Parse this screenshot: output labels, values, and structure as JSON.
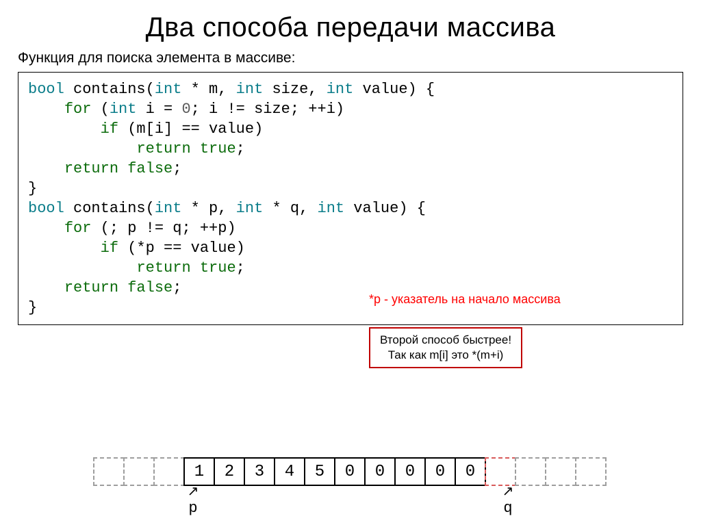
{
  "title": "Два способа передачи массива",
  "subtitle": "Функция для поиска элемента в массиве:",
  "code": {
    "l1": {
      "t1": "bool",
      "t2": " contains(",
      "t3": "int",
      "t4": " * m, ",
      "t5": "int",
      "t6": " size, ",
      "t7": "int",
      "t8": " value) {"
    },
    "l2": {
      "t1": "    ",
      "t2": "for",
      "t3": " (",
      "t4": "int",
      "t5": " i = ",
      "t6": "0",
      "t7": "; i != size; ++i)"
    },
    "l3": {
      "t1": "        ",
      "t2": "if",
      "t3": " (m[i] == value)"
    },
    "l4": {
      "t1": "            ",
      "t2": "return",
      "t3": " ",
      "t4": "true",
      "t5": ";"
    },
    "l5": {
      "t1": "    ",
      "t2": "return",
      "t3": " ",
      "t4": "false",
      "t5": ";"
    },
    "l6": {
      "t1": "}"
    },
    "l7": {
      "t1": "bool",
      "t2": " contains(",
      "t3": "int",
      "t4": " * p, ",
      "t5": "int",
      "t6": " * q, ",
      "t7": "int",
      "t8": " value) {"
    },
    "l8": {
      "t1": "    ",
      "t2": "for",
      "t3": " (; p != q; ++p)"
    },
    "l9": {
      "t1": "        ",
      "t2": "if",
      "t3": " (*p == value)"
    },
    "l10": {
      "t1": "            ",
      "t2": "return",
      "t3": " ",
      "t4": "true",
      "t5": ";"
    },
    "l11": {
      "t1": "    ",
      "t2": "return",
      "t3": " ",
      "t4": "false",
      "t5": ";"
    },
    "l12": {
      "t1": "}"
    }
  },
  "annot_red": "*p - указатель на начало массива",
  "annot_box": {
    "l1": "Второй способ быстрее!",
    "l2": "Так как m[i] это *(m+i)"
  },
  "mem": {
    "cells": [
      "1",
      "2",
      "3",
      "4",
      "5",
      "0",
      "0",
      "0",
      "0",
      "0"
    ],
    "p_label": "p",
    "q_label": "q"
  }
}
